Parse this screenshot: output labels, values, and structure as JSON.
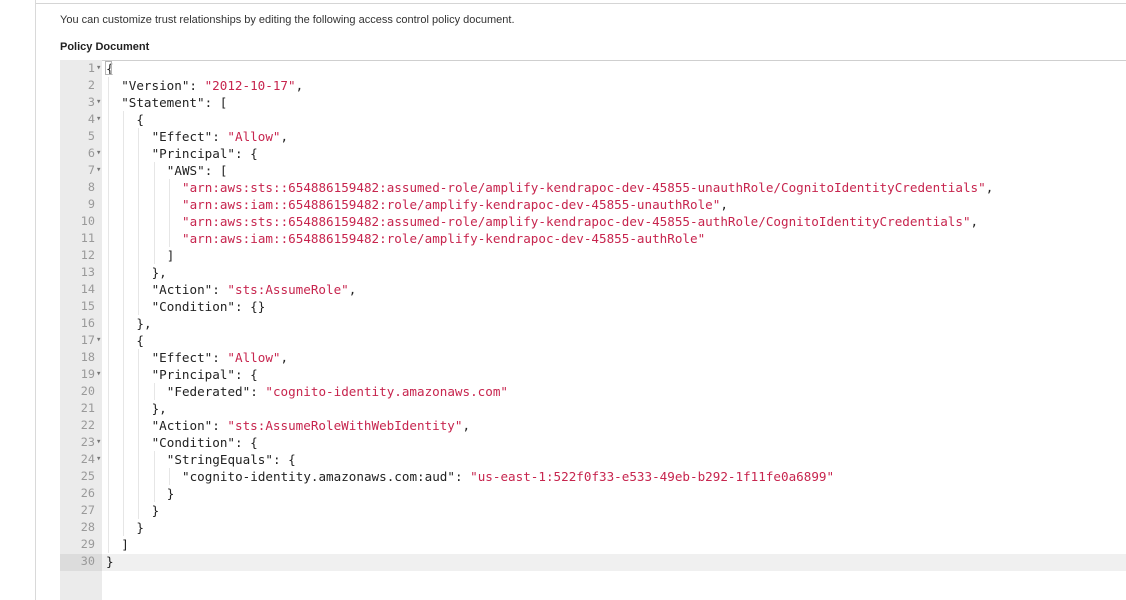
{
  "description": "You can customize trust relationships by editing the following access control policy document.",
  "section_label": "Policy Document",
  "editor": {
    "active_line": 30,
    "lines": [
      {
        "n": "1",
        "fold": true,
        "indent": 0,
        "tokens": [
          {
            "t": "{",
            "c": "punc"
          }
        ]
      },
      {
        "n": "2",
        "fold": false,
        "indent": 2,
        "tokens": [
          {
            "t": "\"Version\": ",
            "c": "key"
          },
          {
            "t": "\"2012-10-17\"",
            "c": "str"
          },
          {
            "t": ",",
            "c": "punc"
          }
        ]
      },
      {
        "n": "3",
        "fold": true,
        "indent": 2,
        "tokens": [
          {
            "t": "\"Statement\": [",
            "c": "key"
          }
        ]
      },
      {
        "n": "4",
        "fold": true,
        "indent": 4,
        "tokens": [
          {
            "t": "{",
            "c": "punc"
          }
        ]
      },
      {
        "n": "5",
        "fold": false,
        "indent": 6,
        "tokens": [
          {
            "t": "\"Effect\": ",
            "c": "key"
          },
          {
            "t": "\"Allow\"",
            "c": "str"
          },
          {
            "t": ",",
            "c": "punc"
          }
        ]
      },
      {
        "n": "6",
        "fold": true,
        "indent": 6,
        "tokens": [
          {
            "t": "\"Principal\": {",
            "c": "key"
          }
        ]
      },
      {
        "n": "7",
        "fold": true,
        "indent": 8,
        "tokens": [
          {
            "t": "\"AWS\": [",
            "c": "key"
          }
        ]
      },
      {
        "n": "8",
        "fold": false,
        "indent": 10,
        "tokens": [
          {
            "t": "\"arn:aws:sts::654886159482:assumed-role/amplify-kendrapoc-dev-45855-unauthRole/CognitoIdentityCredentials\"",
            "c": "str"
          },
          {
            "t": ",",
            "c": "punc"
          }
        ]
      },
      {
        "n": "9",
        "fold": false,
        "indent": 10,
        "tokens": [
          {
            "t": "\"arn:aws:iam::654886159482:role/amplify-kendrapoc-dev-45855-unauthRole\"",
            "c": "str"
          },
          {
            "t": ",",
            "c": "punc"
          }
        ]
      },
      {
        "n": "10",
        "fold": false,
        "indent": 10,
        "tokens": [
          {
            "t": "\"arn:aws:sts::654886159482:assumed-role/amplify-kendrapoc-dev-45855-authRole/CognitoIdentityCredentials\"",
            "c": "str"
          },
          {
            "t": ",",
            "c": "punc"
          }
        ]
      },
      {
        "n": "11",
        "fold": false,
        "indent": 10,
        "tokens": [
          {
            "t": "\"arn:aws:iam::654886159482:role/amplify-kendrapoc-dev-45855-authRole\"",
            "c": "str"
          }
        ]
      },
      {
        "n": "12",
        "fold": false,
        "indent": 8,
        "tokens": [
          {
            "t": "]",
            "c": "punc"
          }
        ]
      },
      {
        "n": "13",
        "fold": false,
        "indent": 6,
        "tokens": [
          {
            "t": "},",
            "c": "punc"
          }
        ]
      },
      {
        "n": "14",
        "fold": false,
        "indent": 6,
        "tokens": [
          {
            "t": "\"Action\": ",
            "c": "key"
          },
          {
            "t": "\"sts:AssumeRole\"",
            "c": "str"
          },
          {
            "t": ",",
            "c": "punc"
          }
        ]
      },
      {
        "n": "15",
        "fold": false,
        "indent": 6,
        "tokens": [
          {
            "t": "\"Condition\": {}",
            "c": "key"
          }
        ]
      },
      {
        "n": "16",
        "fold": false,
        "indent": 4,
        "tokens": [
          {
            "t": "},",
            "c": "punc"
          }
        ]
      },
      {
        "n": "17",
        "fold": true,
        "indent": 4,
        "tokens": [
          {
            "t": "{",
            "c": "punc"
          }
        ]
      },
      {
        "n": "18",
        "fold": false,
        "indent": 6,
        "tokens": [
          {
            "t": "\"Effect\": ",
            "c": "key"
          },
          {
            "t": "\"Allow\"",
            "c": "str"
          },
          {
            "t": ",",
            "c": "punc"
          }
        ]
      },
      {
        "n": "19",
        "fold": true,
        "indent": 6,
        "tokens": [
          {
            "t": "\"Principal\": {",
            "c": "key"
          }
        ]
      },
      {
        "n": "20",
        "fold": false,
        "indent": 8,
        "tokens": [
          {
            "t": "\"Federated\": ",
            "c": "key"
          },
          {
            "t": "\"cognito-identity.amazonaws.com\"",
            "c": "str"
          }
        ]
      },
      {
        "n": "21",
        "fold": false,
        "indent": 6,
        "tokens": [
          {
            "t": "},",
            "c": "punc"
          }
        ]
      },
      {
        "n": "22",
        "fold": false,
        "indent": 6,
        "tokens": [
          {
            "t": "\"Action\": ",
            "c": "key"
          },
          {
            "t": "\"sts:AssumeRoleWithWebIdentity\"",
            "c": "str"
          },
          {
            "t": ",",
            "c": "punc"
          }
        ]
      },
      {
        "n": "23",
        "fold": true,
        "indent": 6,
        "tokens": [
          {
            "t": "\"Condition\": {",
            "c": "key"
          }
        ]
      },
      {
        "n": "24",
        "fold": true,
        "indent": 8,
        "tokens": [
          {
            "t": "\"StringEquals\": {",
            "c": "key"
          }
        ]
      },
      {
        "n": "25",
        "fold": false,
        "indent": 10,
        "tokens": [
          {
            "t": "\"cognito-identity.amazonaws.com:aud\": ",
            "c": "key"
          },
          {
            "t": "\"us-east-1:522f0f33-e533-49eb-b292-1f11fe0a6899\"",
            "c": "str"
          }
        ]
      },
      {
        "n": "26",
        "fold": false,
        "indent": 8,
        "tokens": [
          {
            "t": "}",
            "c": "punc"
          }
        ]
      },
      {
        "n": "27",
        "fold": false,
        "indent": 6,
        "tokens": [
          {
            "t": "}",
            "c": "punc"
          }
        ]
      },
      {
        "n": "28",
        "fold": false,
        "indent": 4,
        "tokens": [
          {
            "t": "}",
            "c": "punc"
          }
        ]
      },
      {
        "n": "29",
        "fold": false,
        "indent": 2,
        "tokens": [
          {
            "t": "]",
            "c": "punc"
          }
        ]
      },
      {
        "n": "30",
        "fold": false,
        "indent": 0,
        "tokens": [
          {
            "t": "}",
            "c": "punc"
          }
        ]
      }
    ]
  },
  "colors": {
    "string": "#c7254e",
    "text": "#222222",
    "gutter_bg": "#ebebeb",
    "line_number": "#999999"
  }
}
